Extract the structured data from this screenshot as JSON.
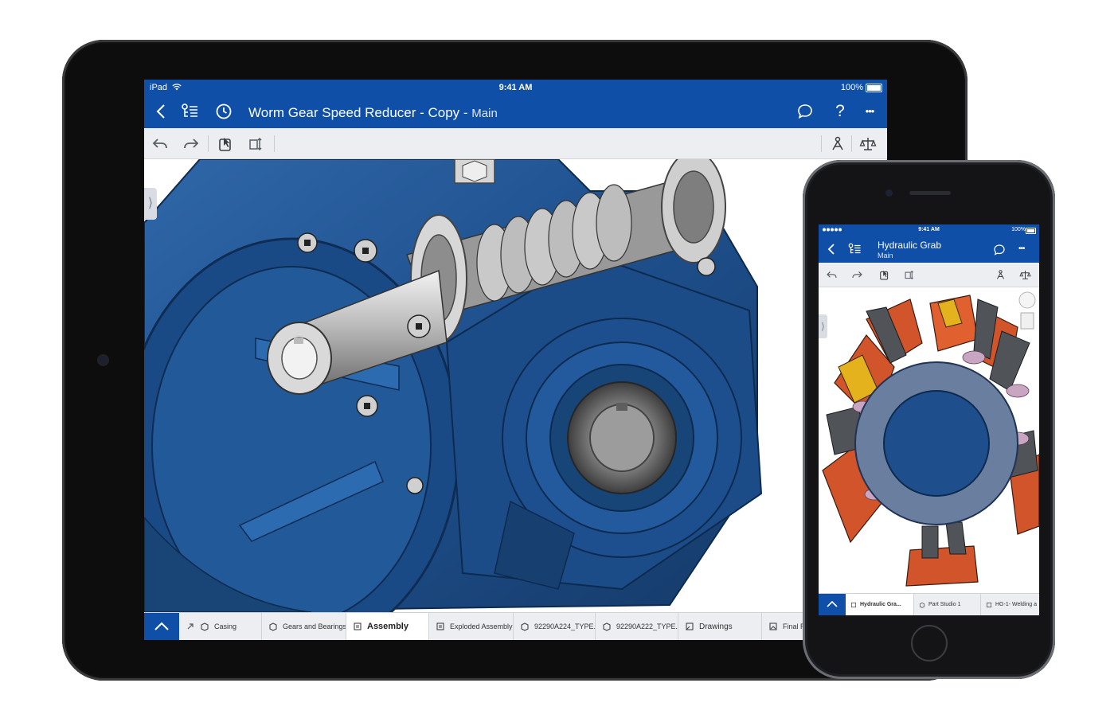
{
  "colors": {
    "brand_blue": "#0f4fa8",
    "toolbar_gray": "#eceef1",
    "model_blue": "#1e4f8c",
    "model_orange": "#d2542a"
  },
  "ipad": {
    "status": {
      "device": "iPad",
      "time": "9:41 AM",
      "battery": "100%"
    },
    "nav": {
      "back_icon": "chevron-left-icon",
      "tree_icon": "feature-tree-icon",
      "history_icon": "clock-icon",
      "title": "Worm Gear Speed Reducer - Copy",
      "separator": " - ",
      "branch": "Main",
      "comment_icon": "comment-icon",
      "help_label": "?",
      "more_label": "•••"
    },
    "toolbar": {
      "undo_icon": "undo-icon",
      "redo_icon": "redo-icon",
      "select_icon": "select-icon",
      "measure_icon": "measure-icon",
      "mate_icon": "mate-connector-icon",
      "balance_icon": "mass-properties-icon"
    },
    "tabs": [
      {
        "label": "Casing",
        "icon": "part-studio-icon",
        "active": false
      },
      {
        "label": "Gears and Bearings",
        "icon": "part-studio-icon",
        "active": false
      },
      {
        "label": "Assembly",
        "icon": "assembly-icon",
        "active": true
      },
      {
        "label": "Exploded Assembly",
        "icon": "assembly-icon",
        "active": false
      },
      {
        "label": "92290A224_TYPE...",
        "icon": "part-studio-icon",
        "active": false
      },
      {
        "label": "92290A222_TYPE...",
        "icon": "part-studio-icon",
        "active": false
      },
      {
        "label": "Drawings",
        "icon": "drawing-icon",
        "active": false
      },
      {
        "label": "Final Re",
        "icon": "image-icon",
        "active": false
      }
    ]
  },
  "iphone": {
    "status": {
      "time": "9:41 AM",
      "battery": "100%"
    },
    "nav": {
      "title": "Hydraulic Grab",
      "branch": "Main"
    },
    "tabs": [
      {
        "label": "Hydraulic Gra...",
        "active": true
      },
      {
        "label": "Part Studio 1",
        "active": false
      },
      {
        "label": "HG-1- Welding a",
        "active": false
      }
    ]
  }
}
